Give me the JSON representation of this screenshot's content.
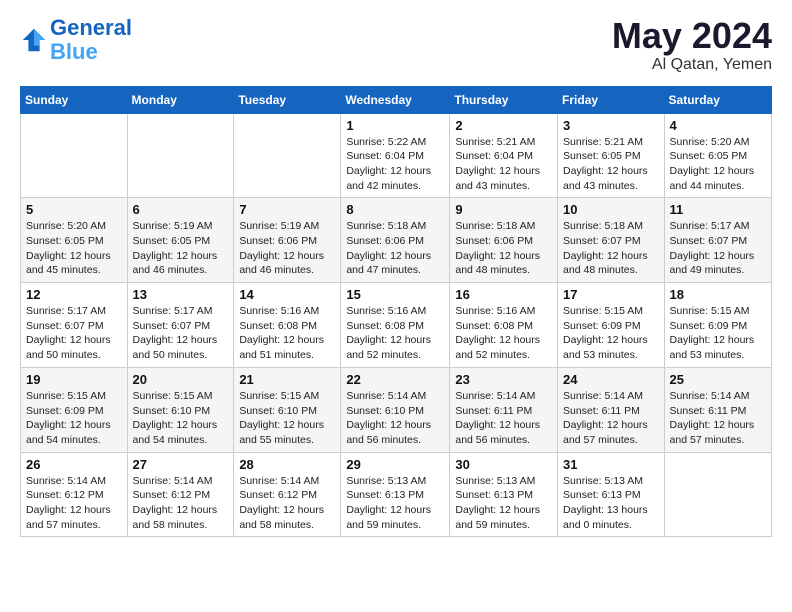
{
  "header": {
    "logo_line1": "General",
    "logo_line2": "Blue",
    "month": "May 2024",
    "location": "Al Qatan, Yemen"
  },
  "weekdays": [
    "Sunday",
    "Monday",
    "Tuesday",
    "Wednesday",
    "Thursday",
    "Friday",
    "Saturday"
  ],
  "weeks": [
    [
      {
        "day": "",
        "info": ""
      },
      {
        "day": "",
        "info": ""
      },
      {
        "day": "",
        "info": ""
      },
      {
        "day": "1",
        "info": "Sunrise: 5:22 AM\nSunset: 6:04 PM\nDaylight: 12 hours and 42 minutes."
      },
      {
        "day": "2",
        "info": "Sunrise: 5:21 AM\nSunset: 6:04 PM\nDaylight: 12 hours and 43 minutes."
      },
      {
        "day": "3",
        "info": "Sunrise: 5:21 AM\nSunset: 6:05 PM\nDaylight: 12 hours and 43 minutes."
      },
      {
        "day": "4",
        "info": "Sunrise: 5:20 AM\nSunset: 6:05 PM\nDaylight: 12 hours and 44 minutes."
      }
    ],
    [
      {
        "day": "5",
        "info": "Sunrise: 5:20 AM\nSunset: 6:05 PM\nDaylight: 12 hours and 45 minutes."
      },
      {
        "day": "6",
        "info": "Sunrise: 5:19 AM\nSunset: 6:05 PM\nDaylight: 12 hours and 46 minutes."
      },
      {
        "day": "7",
        "info": "Sunrise: 5:19 AM\nSunset: 6:06 PM\nDaylight: 12 hours and 46 minutes."
      },
      {
        "day": "8",
        "info": "Sunrise: 5:18 AM\nSunset: 6:06 PM\nDaylight: 12 hours and 47 minutes."
      },
      {
        "day": "9",
        "info": "Sunrise: 5:18 AM\nSunset: 6:06 PM\nDaylight: 12 hours and 48 minutes."
      },
      {
        "day": "10",
        "info": "Sunrise: 5:18 AM\nSunset: 6:07 PM\nDaylight: 12 hours and 48 minutes."
      },
      {
        "day": "11",
        "info": "Sunrise: 5:17 AM\nSunset: 6:07 PM\nDaylight: 12 hours and 49 minutes."
      }
    ],
    [
      {
        "day": "12",
        "info": "Sunrise: 5:17 AM\nSunset: 6:07 PM\nDaylight: 12 hours and 50 minutes."
      },
      {
        "day": "13",
        "info": "Sunrise: 5:17 AM\nSunset: 6:07 PM\nDaylight: 12 hours and 50 minutes."
      },
      {
        "day": "14",
        "info": "Sunrise: 5:16 AM\nSunset: 6:08 PM\nDaylight: 12 hours and 51 minutes."
      },
      {
        "day": "15",
        "info": "Sunrise: 5:16 AM\nSunset: 6:08 PM\nDaylight: 12 hours and 52 minutes."
      },
      {
        "day": "16",
        "info": "Sunrise: 5:16 AM\nSunset: 6:08 PM\nDaylight: 12 hours and 52 minutes."
      },
      {
        "day": "17",
        "info": "Sunrise: 5:15 AM\nSunset: 6:09 PM\nDaylight: 12 hours and 53 minutes."
      },
      {
        "day": "18",
        "info": "Sunrise: 5:15 AM\nSunset: 6:09 PM\nDaylight: 12 hours and 53 minutes."
      }
    ],
    [
      {
        "day": "19",
        "info": "Sunrise: 5:15 AM\nSunset: 6:09 PM\nDaylight: 12 hours and 54 minutes."
      },
      {
        "day": "20",
        "info": "Sunrise: 5:15 AM\nSunset: 6:10 PM\nDaylight: 12 hours and 54 minutes."
      },
      {
        "day": "21",
        "info": "Sunrise: 5:15 AM\nSunset: 6:10 PM\nDaylight: 12 hours and 55 minutes."
      },
      {
        "day": "22",
        "info": "Sunrise: 5:14 AM\nSunset: 6:10 PM\nDaylight: 12 hours and 56 minutes."
      },
      {
        "day": "23",
        "info": "Sunrise: 5:14 AM\nSunset: 6:11 PM\nDaylight: 12 hours and 56 minutes."
      },
      {
        "day": "24",
        "info": "Sunrise: 5:14 AM\nSunset: 6:11 PM\nDaylight: 12 hours and 57 minutes."
      },
      {
        "day": "25",
        "info": "Sunrise: 5:14 AM\nSunset: 6:11 PM\nDaylight: 12 hours and 57 minutes."
      }
    ],
    [
      {
        "day": "26",
        "info": "Sunrise: 5:14 AM\nSunset: 6:12 PM\nDaylight: 12 hours and 57 minutes."
      },
      {
        "day": "27",
        "info": "Sunrise: 5:14 AM\nSunset: 6:12 PM\nDaylight: 12 hours and 58 minutes."
      },
      {
        "day": "28",
        "info": "Sunrise: 5:14 AM\nSunset: 6:12 PM\nDaylight: 12 hours and 58 minutes."
      },
      {
        "day": "29",
        "info": "Sunrise: 5:13 AM\nSunset: 6:13 PM\nDaylight: 12 hours and 59 minutes."
      },
      {
        "day": "30",
        "info": "Sunrise: 5:13 AM\nSunset: 6:13 PM\nDaylight: 12 hours and 59 minutes."
      },
      {
        "day": "31",
        "info": "Sunrise: 5:13 AM\nSunset: 6:13 PM\nDaylight: 13 hours and 0 minutes."
      },
      {
        "day": "",
        "info": ""
      }
    ]
  ]
}
